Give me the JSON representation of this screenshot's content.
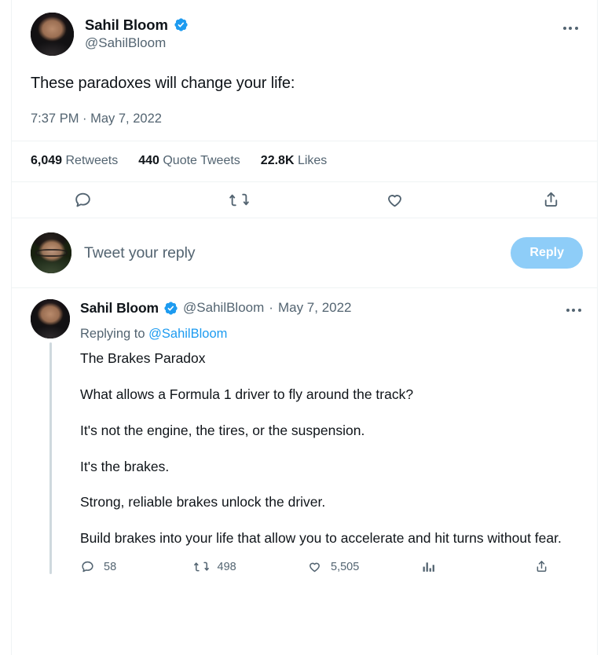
{
  "main_tweet": {
    "author": {
      "display_name": "Sahil Bloom",
      "handle": "@SahilBloom",
      "verified_badge": "verified-badge-icon",
      "avatar": "avatar-sahil-bloom"
    },
    "text": "These paradoxes will change your life:",
    "timestamp": "7:37 PM · May 7, 2022",
    "stats": [
      {
        "count": "6,049",
        "label": "Retweets"
      },
      {
        "count": "440",
        "label": "Quote Tweets"
      },
      {
        "count": "22.8K",
        "label": "Likes"
      }
    ],
    "actions": [
      {
        "name": "reply-icon"
      },
      {
        "name": "retweet-icon"
      },
      {
        "name": "like-icon"
      },
      {
        "name": "share-icon"
      }
    ],
    "more_menu": "more-options-icon"
  },
  "composer": {
    "placeholder": "Tweet your reply",
    "reply_button": "Reply",
    "avatar": "avatar-current-user"
  },
  "thread_reply": {
    "author": {
      "display_name": "Sahil Bloom",
      "handle": "@SahilBloom",
      "verified_badge": "verified-badge-icon",
      "avatar": "avatar-sahil-bloom"
    },
    "separator": "·",
    "date": "May 7, 2022",
    "replying_to_label": "Replying to",
    "replying_to_handle": "@SahilBloom",
    "paragraphs": [
      "The Brakes Paradox",
      "What allows a Formula 1 driver to fly around the track?",
      "It's not the engine, the tires, or the suspension.",
      "It's the brakes.",
      "Strong, reliable brakes unlock the driver.",
      "Build brakes into your life that allow you to accelerate and hit turns without fear."
    ],
    "actions": [
      {
        "name": "reply-icon",
        "count": "58"
      },
      {
        "name": "retweet-icon",
        "count": "498"
      },
      {
        "name": "like-icon",
        "count": "5,505"
      },
      {
        "name": "analytics-icon",
        "count": ""
      },
      {
        "name": "share-icon",
        "count": ""
      }
    ],
    "more_menu": "more-options-icon"
  },
  "colors": {
    "twitter_blue": "#1D9BF0",
    "reply_button_muted": "#8ECDF8",
    "text_primary": "#0F1419",
    "text_secondary": "#536471",
    "border": "#EFF3F4",
    "thread_line": "#CFD9DE"
  }
}
